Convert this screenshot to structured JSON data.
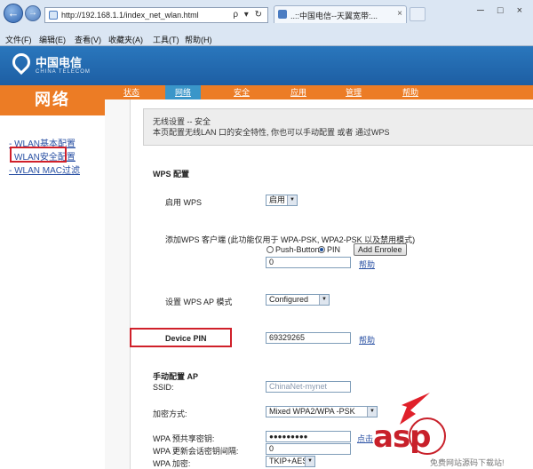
{
  "browser": {
    "back_icon": "back-arrow-icon",
    "forward_icon": "forward-arrow-icon",
    "address": "http://192.168.1.1/index_net_wlan.html",
    "address_tools": "ρ ▾ ↻",
    "tab_title": "..::中国电信--天翼宽带:...",
    "tab_close": "×",
    "window_controls": "─ □ ×",
    "menu": [
      "文件(F)",
      "编辑(E)",
      "查看(V)",
      "收藏夹(A)",
      "工具(T)",
      "帮助(H)"
    ]
  },
  "portal": {
    "logo_cn": "中国电信",
    "logo_en": "CHINA TELECOM",
    "section_title": "网络",
    "nav_tabs": [
      "状态",
      "网络",
      "安全",
      "应用",
      "管理",
      "帮助"
    ],
    "active_tab": "网络",
    "colors": {
      "header_blue": "#2a77bd",
      "nav_orange": "#ec7c25",
      "active_tab": "#3a96c9",
      "highlight_red": "#d0202a"
    }
  },
  "sidebar": {
    "items": [
      "- WLAN基本配置",
      "WLAN安全配置",
      "- WLAN MAC过滤"
    ]
  },
  "main": {
    "info_title": "无线设置 -- 安全",
    "info_desc": "本页配置无线LAN 口的安全特性, 你也可以手动配置 或者 通过WPS",
    "wps_heading": "WPS 配置",
    "enable_wps_label": "启用 WPS",
    "enable_wps_value": "启用",
    "add_client_label": "添加WPS 客户端 (此功能仅用于 WPA-PSK, WPA2-PSK 以及禁用模式)",
    "radio_push": "Push-Button",
    "radio_pin": "PIN",
    "add_enrolee_button": "Add Enrolee",
    "pin_input_value": "0",
    "help_link": "帮助",
    "wps_ap_mode_label": "设置 WPS AP 模式",
    "wps_ap_mode_value": "Configured",
    "device_pin_label": "Device PIN",
    "device_pin_value": "69329265",
    "manual_heading": "手动配置 AP",
    "ssid_label": "SSID:",
    "ssid_value": "ChinaNet-mynet",
    "encryption_label": "加密方式:",
    "encryption_value": "Mixed WPA2/WPA -PSK",
    "psk_label": "WPA 预共享密钥:",
    "psk_value": "●●●●●●●●●",
    "psk_link": "点击",
    "rekey_label": "WPA 更新会话密钥间隔:",
    "rekey_value": "0",
    "wpa_encrypt_label": "WPA 加密:",
    "wpa_encrypt_value": "TKIP+AES"
  },
  "watermark": {
    "text": "asp",
    "sub": "免费网站源码下载站!"
  }
}
